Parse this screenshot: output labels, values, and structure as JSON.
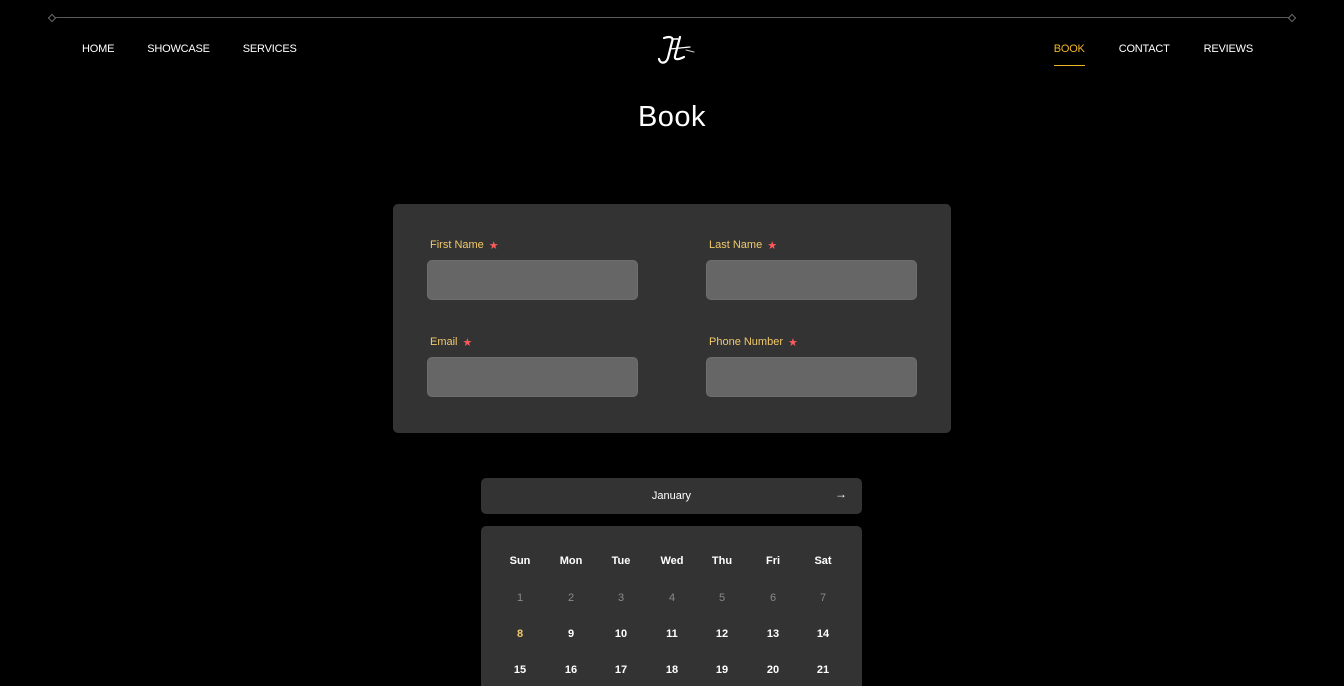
{
  "nav": {
    "left": [
      "HOME",
      "SHOWCASE",
      "SERVICES"
    ],
    "right": [
      "BOOK",
      "CONTACT",
      "REVIEWS"
    ],
    "active": "BOOK"
  },
  "logo_text": "JL",
  "page": {
    "title": "Book"
  },
  "form": {
    "first_name": {
      "label": "First Name",
      "value": ""
    },
    "last_name": {
      "label": "Last Name",
      "value": ""
    },
    "email": {
      "label": "Email",
      "value": ""
    },
    "phone": {
      "label": "Phone Number",
      "value": ""
    }
  },
  "calendar": {
    "month": "January",
    "next_icon": "arrow-right-icon",
    "weekdays": [
      "Sun",
      "Mon",
      "Tue",
      "Wed",
      "Thu",
      "Fri",
      "Sat"
    ],
    "weeks": [
      [
        "1",
        "2",
        "3",
        "4",
        "5",
        "6",
        "7"
      ],
      [
        "8",
        "9",
        "10",
        "11",
        "12",
        "13",
        "14"
      ],
      [
        "15",
        "16",
        "17",
        "18",
        "19",
        "20",
        "21"
      ]
    ],
    "today": "8"
  },
  "colors": {
    "accent": "#f0b429",
    "label": "#f0c96a",
    "required": "#ff5a5a",
    "card": "#333333",
    "input": "#666666"
  }
}
